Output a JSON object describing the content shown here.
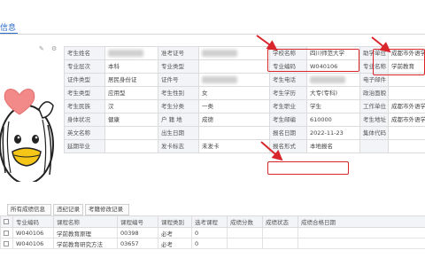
{
  "page": {
    "title": "信息"
  },
  "photo": {
    "alt": "学生照片",
    "actions": [
      "edit-icon",
      "settings-icon"
    ]
  },
  "info": {
    "rows": [
      [
        {
          "label": "考生姓名",
          "value": "███",
          "blur": true
        },
        {
          "label": "准考证号",
          "value": "0████████",
          "blur": true
        },
        {
          "label": "学校名称",
          "value": "四川师范大学"
        },
        {
          "label": "助学单位",
          "value": "成都市外语学"
        }
      ],
      [
        {
          "label": "专业层次",
          "value": "本科"
        },
        {
          "label": "专业类型",
          "value": ""
        },
        {
          "label": "专业编码",
          "value": "W040106"
        },
        {
          "label": "专业名称",
          "value": "学前教育"
        }
      ],
      [
        {
          "label": "证件类型",
          "value": "居民身份证"
        },
        {
          "label": "证件号",
          "value": "51█████████",
          "blur": true
        },
        {
          "label": "考生电话",
          "value": "1█████",
          "blur": true
        },
        {
          "label": "电子邮件",
          "value": ""
        }
      ],
      [
        {
          "label": "考生类型",
          "value": "应用型"
        },
        {
          "label": "考生性别",
          "value": "女"
        },
        {
          "label": "考生学历",
          "value": "大专(专科)"
        },
        {
          "label": "政治面貌",
          "value": ""
        }
      ],
      [
        {
          "label": "考生民族",
          "value": "汉"
        },
        {
          "label": "考生分类",
          "value": "一类"
        },
        {
          "label": "考生职业",
          "value": "学生"
        },
        {
          "label": "工作单位",
          "value": "成都市外语学"
        }
      ],
      [
        {
          "label": "身体状况",
          "value": "健康"
        },
        {
          "label": "户 籍 地",
          "value": "成德"
        },
        {
          "label": "考生邮编",
          "value": "610000"
        },
        {
          "label": "考生地址",
          "value": "成都市外语学"
        }
      ],
      [
        {
          "label": "英文名称",
          "value": ""
        },
        {
          "label": "出生日期",
          "value": ""
        },
        {
          "label": "报名日期",
          "value": "2022-11-23"
        },
        {
          "label": "集体代码",
          "value": ""
        }
      ],
      [
        {
          "label": "延期毕业",
          "value": ""
        },
        {
          "label": "发卡标志",
          "value": "未发卡"
        },
        {
          "label": "报名形式",
          "value": "本地报名"
        },
        {
          "label": "",
          "value": ""
        }
      ]
    ]
  },
  "tabs": [
    {
      "label": "所有成绩信息"
    },
    {
      "label": "违纪记录"
    },
    {
      "label": "考籍修改记录"
    }
  ],
  "grid": {
    "headers": [
      "",
      "专业编码",
      "课程名称",
      "课程编号",
      "课程类别",
      "选考课程",
      "成绩分数",
      "成绩状态",
      "成绩合格日期"
    ],
    "rows": [
      [
        "",
        "W040106",
        "学前教育原理",
        "00398",
        "必考",
        "0",
        "",
        "",
        ""
      ],
      [
        "",
        "W040106",
        "学前教育研究方法",
        "03657",
        "必考",
        "0",
        "",
        "",
        ""
      ]
    ]
  },
  "colors": {
    "accent": "#2a6ac8",
    "highlight": "#d9262c"
  }
}
